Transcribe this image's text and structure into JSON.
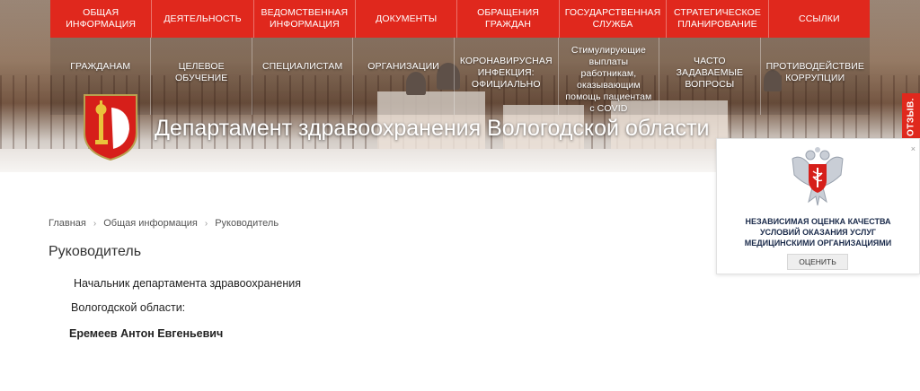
{
  "menu": {
    "row1": [
      {
        "label": "Общая информация"
      },
      {
        "label": "Деятельность"
      },
      {
        "label": "Ведомственная информация"
      },
      {
        "label": "Документы"
      },
      {
        "label": "Обращения граждан"
      },
      {
        "label": "Государственная служба"
      },
      {
        "label": "Стратегическое планирование"
      },
      {
        "label": "Ссылки"
      }
    ],
    "row2": [
      {
        "label": "Гражданам"
      },
      {
        "label": "Целевое обучение"
      },
      {
        "label": "Специалистам"
      },
      {
        "label": "Организации"
      },
      {
        "label": "Коронавирусная инфекция: официально"
      },
      {
        "label": "Стимулирующие выплаты работникам, оказывающим помощь пациентам с COVID"
      },
      {
        "label": "Часто задаваемые вопросы"
      },
      {
        "label": "Противодействие коррупции"
      }
    ]
  },
  "header": {
    "title": "Департамент здравоохранения Вологодской области",
    "emblem_icon": "vologda-coat-of-arms-icon"
  },
  "feedback": {
    "label": "ОТЗЫВ."
  },
  "widget": {
    "close_label": "×",
    "emblem_icon": "russian-eagle-health-icon",
    "text_line1": "Независимая оценка качества",
    "text_line2": "условий оказания услуг",
    "text_line3": "медицинскими организациями",
    "button_label": "Оценить"
  },
  "breadcrumb": {
    "items": [
      "Главная",
      "Общая информация",
      "Руководитель"
    ],
    "separator": "›"
  },
  "page": {
    "title": "Руководитель",
    "line1": "Начальник департамента здравоохранения",
    "line2": "Вологодской области:",
    "line3": "Еремеев Антон Евгеньевич"
  },
  "colors": {
    "accent": "#e0281d",
    "text": "#333333",
    "widget_text": "#1a2a4a"
  }
}
